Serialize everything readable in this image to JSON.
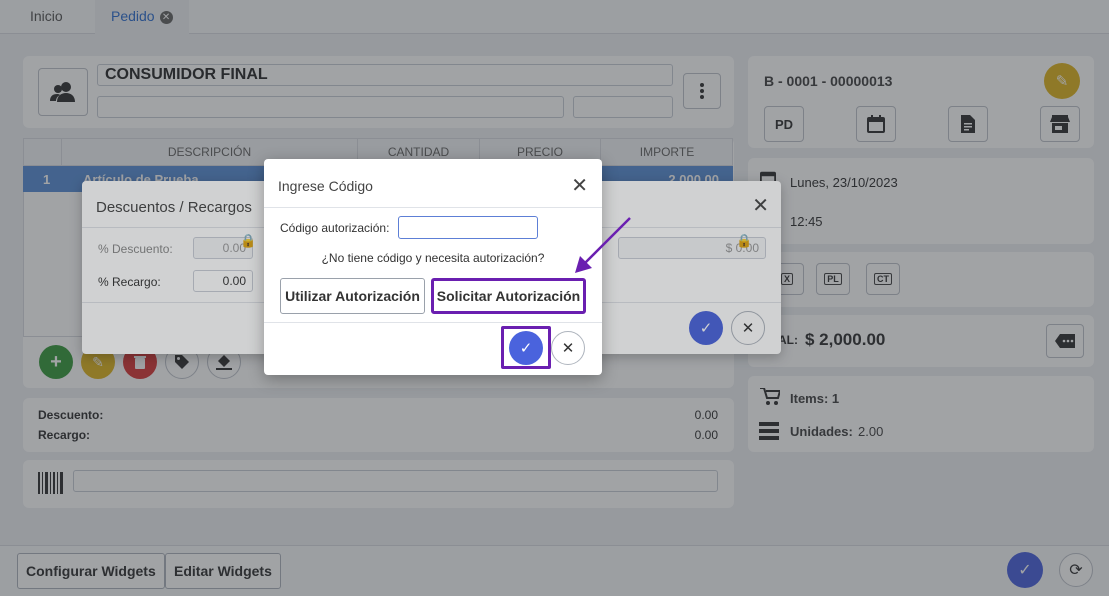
{
  "tabs": [
    {
      "label": "Inicio"
    },
    {
      "label": "Pedido",
      "close_icon": "close-circle-icon"
    }
  ],
  "customer": {
    "name": "CONSUMIDOR FINAL",
    "avatar_icon": "users-icon",
    "menu_icon": "kebab-menu-icon"
  },
  "table": {
    "headers": [
      "DESCRIPCIÓN",
      "CANTIDAD",
      "PRECIO",
      "IMPORTE"
    ],
    "selected_row": {
      "index": "1",
      "description": "Artículo de Prueba",
      "importe": "2,000.00"
    }
  },
  "actions": [
    {
      "name": "add-button",
      "icon": "plus-icon",
      "color": "#3a9a3e"
    },
    {
      "name": "edit-button",
      "icon": "pencil-icon",
      "color": "#e0b622"
    },
    {
      "name": "delete-button",
      "icon": "trash-icon",
      "color": "#d83a3a"
    },
    {
      "name": "tag-button",
      "icon": "tag-icon"
    },
    {
      "name": "fill-button",
      "icon": "paint-bucket-icon"
    }
  ],
  "summary": {
    "descuento_label": "Descuento:",
    "descuento_value": "0.00",
    "recargo_label": "Recargo:",
    "recargo_value": "0.00"
  },
  "document": {
    "number": "B - 0001 - 00000013",
    "pd_label": "PD",
    "date": "Lunes, 23/10/2023",
    "time": "12:45",
    "tags": [
      "X",
      "PL",
      "CT"
    ],
    "total_label_visible": "AL:",
    "total_value": "$ 2,000.00",
    "items_label": "Items: 1",
    "unidades_label": "Unidades:",
    "unidades_value": "2.00"
  },
  "bottom": {
    "configurar": "Configurar Widgets",
    "editar": "Editar Widgets"
  },
  "descuentos_dialog": {
    "title": "Descuentos / Recargos",
    "descuento_label": "% Descuento:",
    "descuento_value": "0.00",
    "recargo_label": "% Recargo:",
    "recargo_value": "0.00",
    "right_value": "$ 0.00"
  },
  "codigo_dialog": {
    "title": "Ingrese Código",
    "codigo_label": "Código autorización:",
    "codigo_value": "",
    "question": "¿No tiene código y necesita autorización?",
    "utilizar": "Utilizar Autorización",
    "solicitar": "Solicitar Autorización"
  },
  "colors": {
    "accent": "#4a63dd",
    "highlight": "#6a1fb0",
    "selected_row": "#5b8fd6"
  }
}
